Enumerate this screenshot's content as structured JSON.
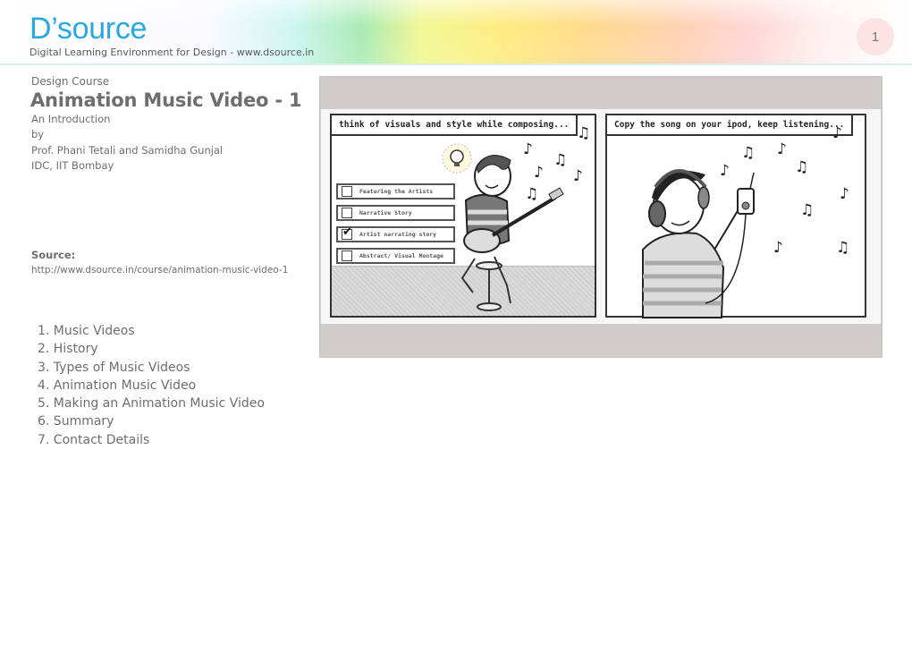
{
  "header": {
    "logo": "D’source",
    "tagline": "Digital Learning Environment for Design - www.dsource.in",
    "page_number": "1",
    "colors": {
      "logo": "#2aa8e0",
      "page_badge_bg": "#fde3e3"
    }
  },
  "course": {
    "category": "Design Course",
    "title": "Animation Music Video - 1",
    "subtitle": "An Introduction",
    "by": "by",
    "authors": "Prof. Phani Tetali and Samidha Gunjal",
    "institute": "IDC, IIT Bombay"
  },
  "source": {
    "label": "Source:",
    "url": "http://www.dsource.in/course/animation-music-video-1"
  },
  "toc": [
    "1. Music Videos",
    "2. History",
    "3. Types of Music Videos",
    "4. Animation Music Video",
    "5. Making an Animation Music Video",
    "6. Summary",
    "7. Contact Details"
  ],
  "illustration": {
    "left_panel": {
      "caption": "think of visuals and style while composing...",
      "options": [
        {
          "label": "Featuring the Artists",
          "checked": false
        },
        {
          "label": "Narrative Story",
          "checked": false
        },
        {
          "label": "Artist narrating story",
          "checked": true
        },
        {
          "label": "Abstract/ Visual Montage",
          "checked": false
        }
      ],
      "icons": [
        "lightbulb-icon",
        "guitar-player",
        "music-note-icon"
      ]
    },
    "right_panel": {
      "caption": "Copy the song on your ipod, keep listening...",
      "icons": [
        "headphones-listener",
        "ipod-icon",
        "music-note-icon"
      ]
    },
    "note_glyphs": [
      "♫",
      "♪"
    ]
  }
}
